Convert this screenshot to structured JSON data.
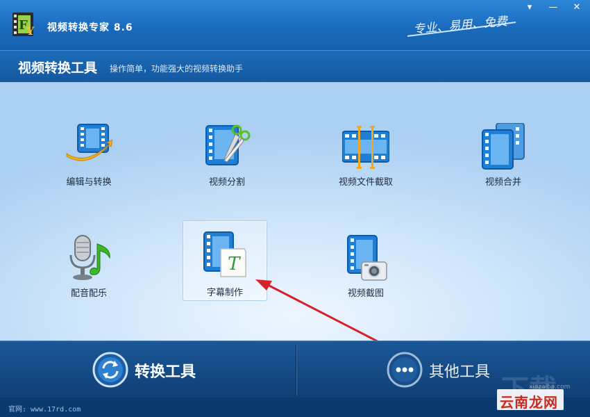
{
  "window": {
    "title": "视频转换专家 8.6",
    "slogan": "专业、易用、免费",
    "controls": {
      "menu": "▾",
      "minimize": "—",
      "close": "✕"
    }
  },
  "header": {
    "title": "视频转换工具",
    "subtitle": "操作简单，功能强大的视频转换助手"
  },
  "tools": [
    {
      "id": "edit-convert",
      "label": "编辑与转换",
      "icon": "film-swoosh-icon"
    },
    {
      "id": "split",
      "label": "视频分割",
      "icon": "film-scissors-icon"
    },
    {
      "id": "clip",
      "label": "视频文件截取",
      "icon": "film-strip-markers-icon"
    },
    {
      "id": "merge",
      "label": "视频合并",
      "icon": "film-stack-icon"
    },
    {
      "id": "dub",
      "label": "配音配乐",
      "icon": "microphone-music-icon"
    },
    {
      "id": "subtitle",
      "label": "字幕制作",
      "icon": "film-text-icon",
      "selected": true
    },
    {
      "id": "screenshot",
      "label": "视频截图",
      "icon": "film-camera-icon"
    }
  ],
  "bottom": {
    "convert_label": "转换工具",
    "other_label": "其他工具"
  },
  "status": {
    "site": "官网: www.17rd.com"
  },
  "watermark": {
    "big": "下载吧",
    "small": "xiazaiba.com",
    "brand": "云南龙网"
  },
  "colors": {
    "accent": "#1a6bbd",
    "arrow": "#d8202a"
  }
}
